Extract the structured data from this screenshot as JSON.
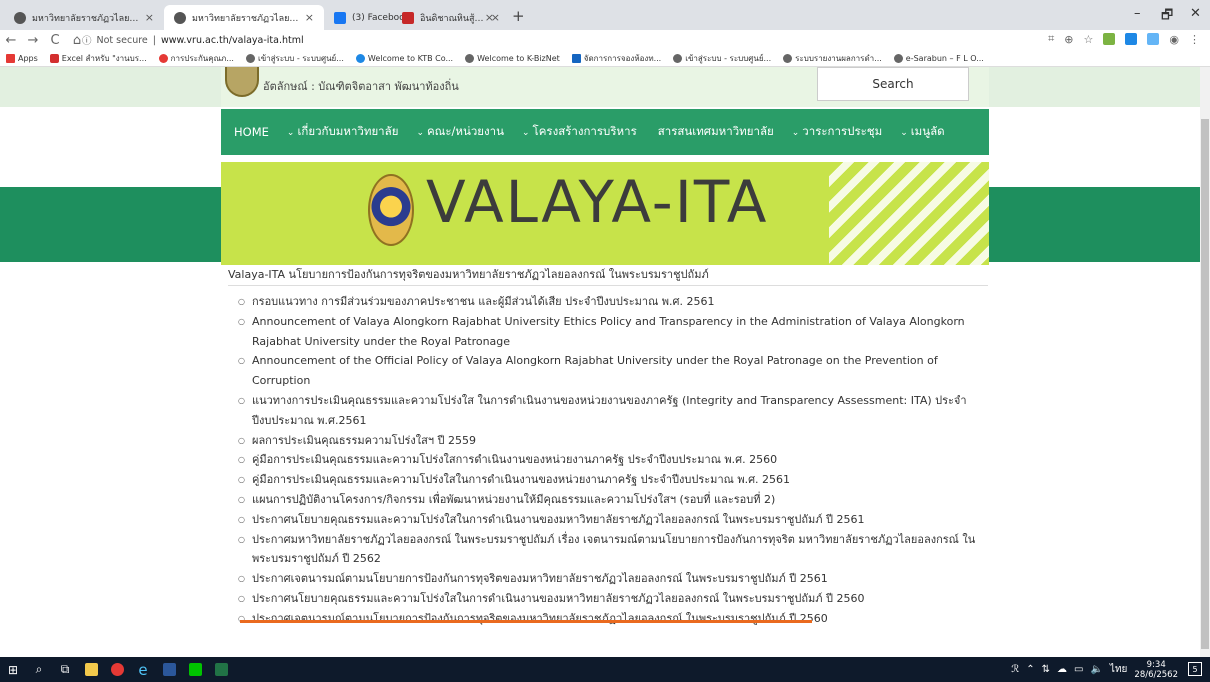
{
  "browser": {
    "tabs": [
      {
        "title": "มหาวิทยาลัยราชภัฏวไลยอลงกรณ์ ในพร",
        "close": "×",
        "color": "#555"
      },
      {
        "title": "มหาวิทยาลัยราชภัฏวไลยอลงกรณ์ ในพร",
        "close": "×",
        "color": "#555"
      },
      {
        "title": "(3) Facebook",
        "close": "×",
        "color": "#1877f2"
      },
      {
        "title": "อินดิชาณหินสู้มหาวิทยาลัยราชภัฏนคร",
        "close": "×",
        "color": "#c62828"
      }
    ],
    "new_tab": "+",
    "window_controls": {
      "minimize": "–",
      "maximize": "🗗",
      "close": "✕"
    },
    "nav": {
      "back": "←",
      "forward": "→",
      "reload": "C",
      "home": "⌂"
    },
    "security_label": "Not secure",
    "url": "www.vru.ac.th/valaya-ita.html",
    "bookmarks": [
      {
        "label": "Apps",
        "color": "#555"
      },
      {
        "label": "Excel สำหรับ \"งานบร...",
        "color": "#d32f2f"
      },
      {
        "label": "การประกันคุณภ...",
        "color": "#e53935"
      },
      {
        "label": "เข้าสู่ระบบ - ระบบศูนย์...",
        "color": "#666"
      },
      {
        "label": "Welcome to KTB Co...",
        "color": "#1e88e5"
      },
      {
        "label": "Welcome to K-BizNet",
        "color": "#666"
      },
      {
        "label": "จัดการการจองห้องท...",
        "color": "#1565c0"
      },
      {
        "label": "เข้าสู่ระบบ - ระบบศูนย์...",
        "color": "#666"
      },
      {
        "label": "ระบบรายงานผลการดำ...",
        "color": "#666"
      },
      {
        "label": "e-Sarabun – F L O...",
        "color": "#666"
      }
    ]
  },
  "site": {
    "motto": "อัตลักษณ์ : บัณฑิตจิตอาสา พัฒนาท้องถิ่น",
    "search_label": "Search",
    "nav": [
      {
        "label": "HOME",
        "caret": ""
      },
      {
        "label": "เกี่ยวกับมหาวิทยาลัย",
        "caret": "⌄"
      },
      {
        "label": "คณะ/หน่วยงาน",
        "caret": "⌄"
      },
      {
        "label": "โครงสร้างการบริหาร",
        "caret": "⌄"
      },
      {
        "label": "สารสนเทศมหาวิทยาลัย",
        "caret": ""
      },
      {
        "label": "วาระการประชุม",
        "caret": "⌄"
      },
      {
        "label": "เมนูลัด",
        "caret": "⌄"
      }
    ],
    "banner_title": "VALAYA-ITA",
    "page_title": "Valaya-ITA นโยบายการป้องกันการทุจริตของมหาวิทยาลัยราชภัฏวไลยอลงกรณ์ ในพระบรมราชูปถัมภ์",
    "links": [
      "กรอบแนวทาง การมีส่วนร่วมของภาคประชาชน และผู้มีส่วนได้เสีย ประจำปีงบประมาณ พ.ศ. 2561",
      "Announcement of Valaya Alongkorn Rajabhat University Ethics Policy and Transparency in the Administration of Valaya Alongkorn Rajabhat University under the Royal Patronage",
      "Announcement of the Official Policy of Valaya Alongkorn Rajabhat University under the Royal Patronage on the Prevention of Corruption",
      "แนวทางการประเมินคุณธรรมและความโปร่งใส ในการดำเนินงานของหน่วยงานของภาครัฐ (Integrity and Transparency Assessment: ITA) ประจำปีงบประมาณ พ.ศ.2561",
      "ผลการประเมินคุณธรรมความโปร่งใสฯ ปี 2559",
      "คู่มือการประเมินคุณธรรมและความโปร่งใสการดำเนินงานของหน่วยงานภาครัฐ ประจำปีงบประมาณ พ.ศ. 2560",
      "คู่มือการประเมินคุณธรรมและความโปร่งใสในการดำเนินงานของหน่วยงานภาครัฐ ประจำปีงบประมาณ พ.ศ. 2561",
      "แผนการปฏิบัติงานโครงการ/กิจกรรม เพื่อพัฒนาหน่วยงานให้มีคุณธรรมและความโปร่งใสฯ (รอบที่ และรอบที่ 2)",
      "ประกาศนโยบายคุณธรรมและความโปร่งใสในการดำเนินงานของมหาวิทยาลัยราชภัฏวไลยอลงกรณ์ ในพระบรมราชูปถัมภ์ ปี 2561",
      "ประกาศมหาวิทยาลัยราชภัฏวไลยอลงกรณ์ ในพระบรมราชูปถัมภ์ เรื่อง เจตนารมณ์ตามนโยบายการป้องกันการทุจริต มหาวิทยาลัยราชภัฏวไลยอลงกรณ์ ในพระบรมราชูปถัมภ์ ปี 2562",
      "ประกาศเจตนารมณ์ตามนโยบายการป้องกันการทุจริตของมหาวิทยาลัยราชภัฏวไลยอลงกรณ์ ในพระบรมราชูปถัมภ์ ปี 2561",
      "ประกาศนโยบายคุณธรรมและความโปร่งใสในการดำเนินงานของมหาวิทยาลัยราชภัฏวไลยอลงกรณ์ ในพระบรมราชูปถัมภ์ ปี 2560",
      "ประกาศเจตนารมณ์ตามนโยบายการป้องกันการทุจริตของมหาวิทยาลัยราชภัฏวไลยอลงกรณ์ ในพระบรมราชูปถัมภ์ ปี 2560"
    ],
    "highlight_color": "#ea6a1f"
  },
  "taskbar": {
    "clock_time": "9:34",
    "clock_date": "28/6/2562",
    "lang": "ไทย",
    "notifications": "5"
  }
}
